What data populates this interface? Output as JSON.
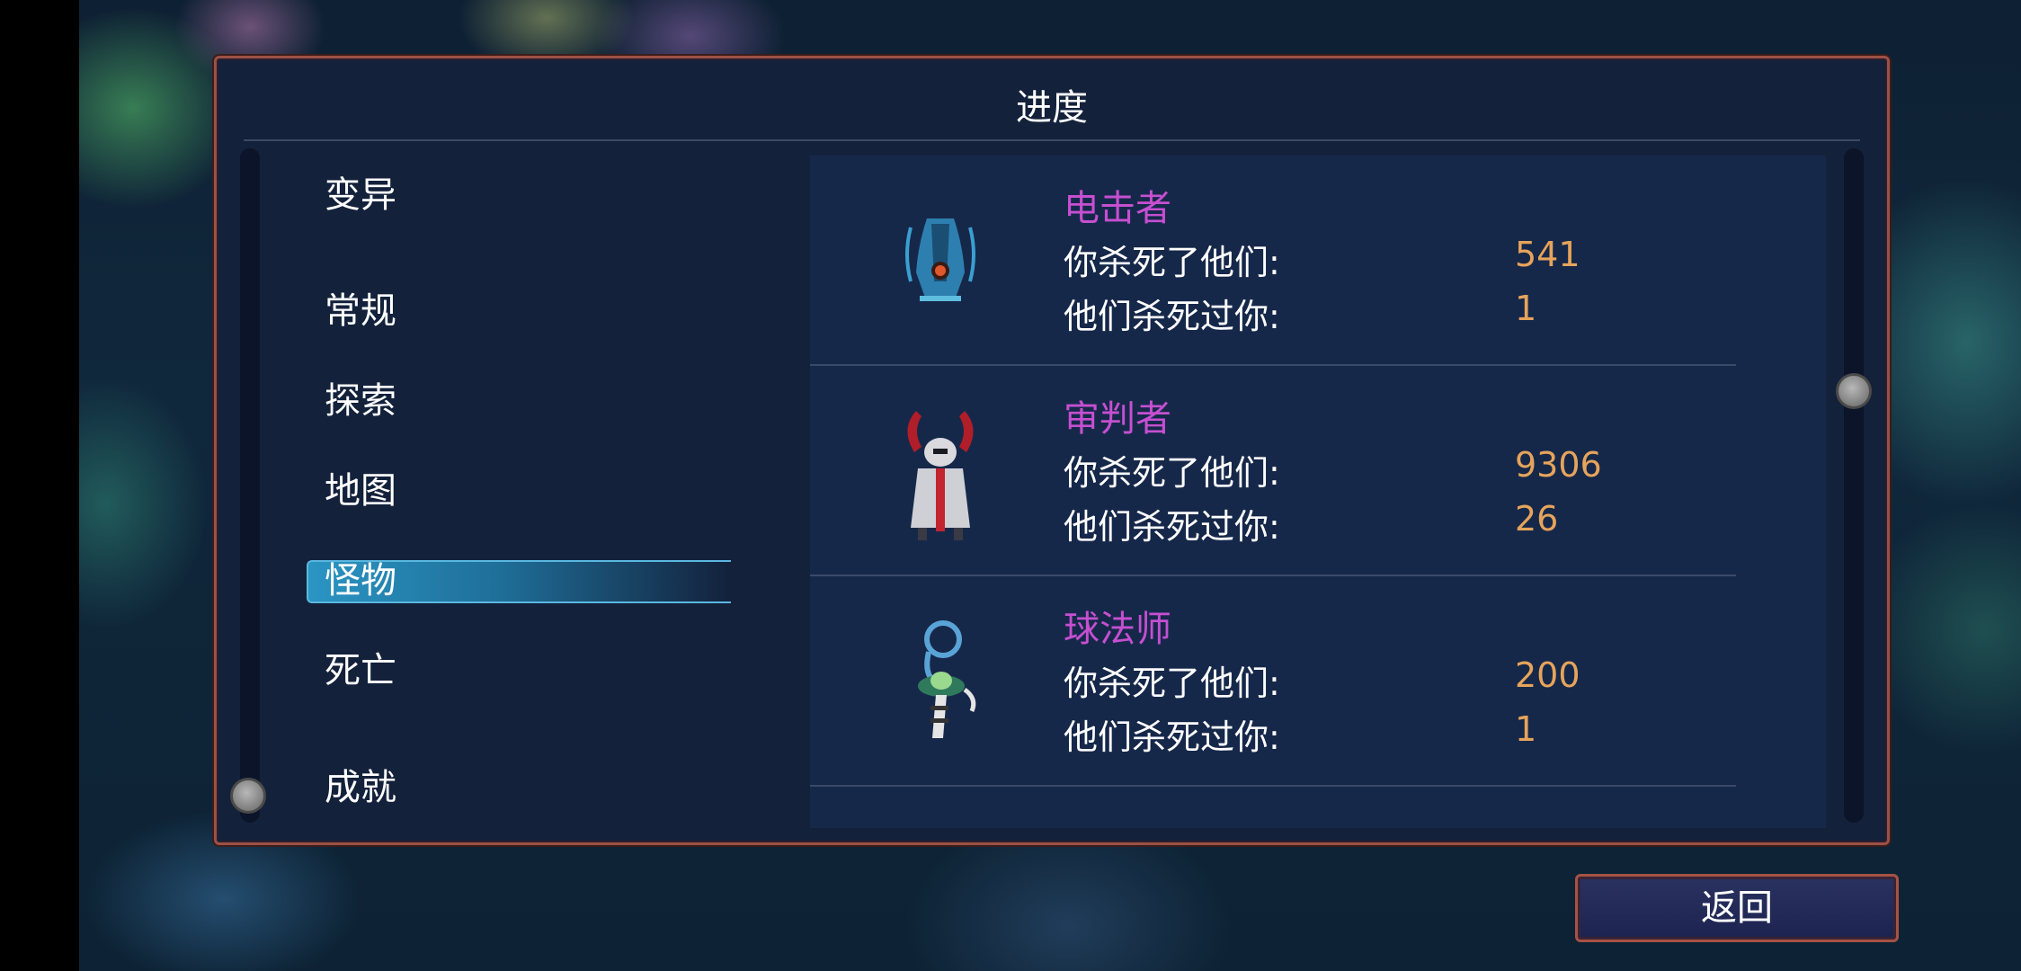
{
  "panel": {
    "title": "进度"
  },
  "menu": {
    "items": [
      {
        "label": "变异"
      },
      {
        "label": "常规"
      },
      {
        "label": "探索"
      },
      {
        "label": "地图"
      },
      {
        "label": "怪物",
        "selected": true
      },
      {
        "label": "死亡"
      },
      {
        "label": "成就"
      }
    ]
  },
  "enemies": [
    {
      "name": "电击者",
      "kills_label": "你杀死了他们:",
      "kills_value": "541",
      "deaths_label": "他们杀死过你:",
      "deaths_value": "1",
      "icon": "shocker-enemy-icon"
    },
    {
      "name": "审判者",
      "kills_label": "你杀死了他们:",
      "kills_value": "9306",
      "deaths_label": "他们杀死过你:",
      "deaths_value": "26",
      "icon": "inquisitor-enemy-icon"
    },
    {
      "name": "球法师",
      "kills_label": "你杀死了他们:",
      "kills_value": "200",
      "deaths_label": "他们杀死过你:",
      "deaths_value": "1",
      "icon": "orb-mage-enemy-icon"
    }
  ],
  "back_button": {
    "label": "返回"
  },
  "colors": {
    "enemy_name": "#c64fd1",
    "stat_value": "#e6a45b",
    "panel_border": "#9c5146",
    "menu_highlight": "#2b95c3"
  }
}
